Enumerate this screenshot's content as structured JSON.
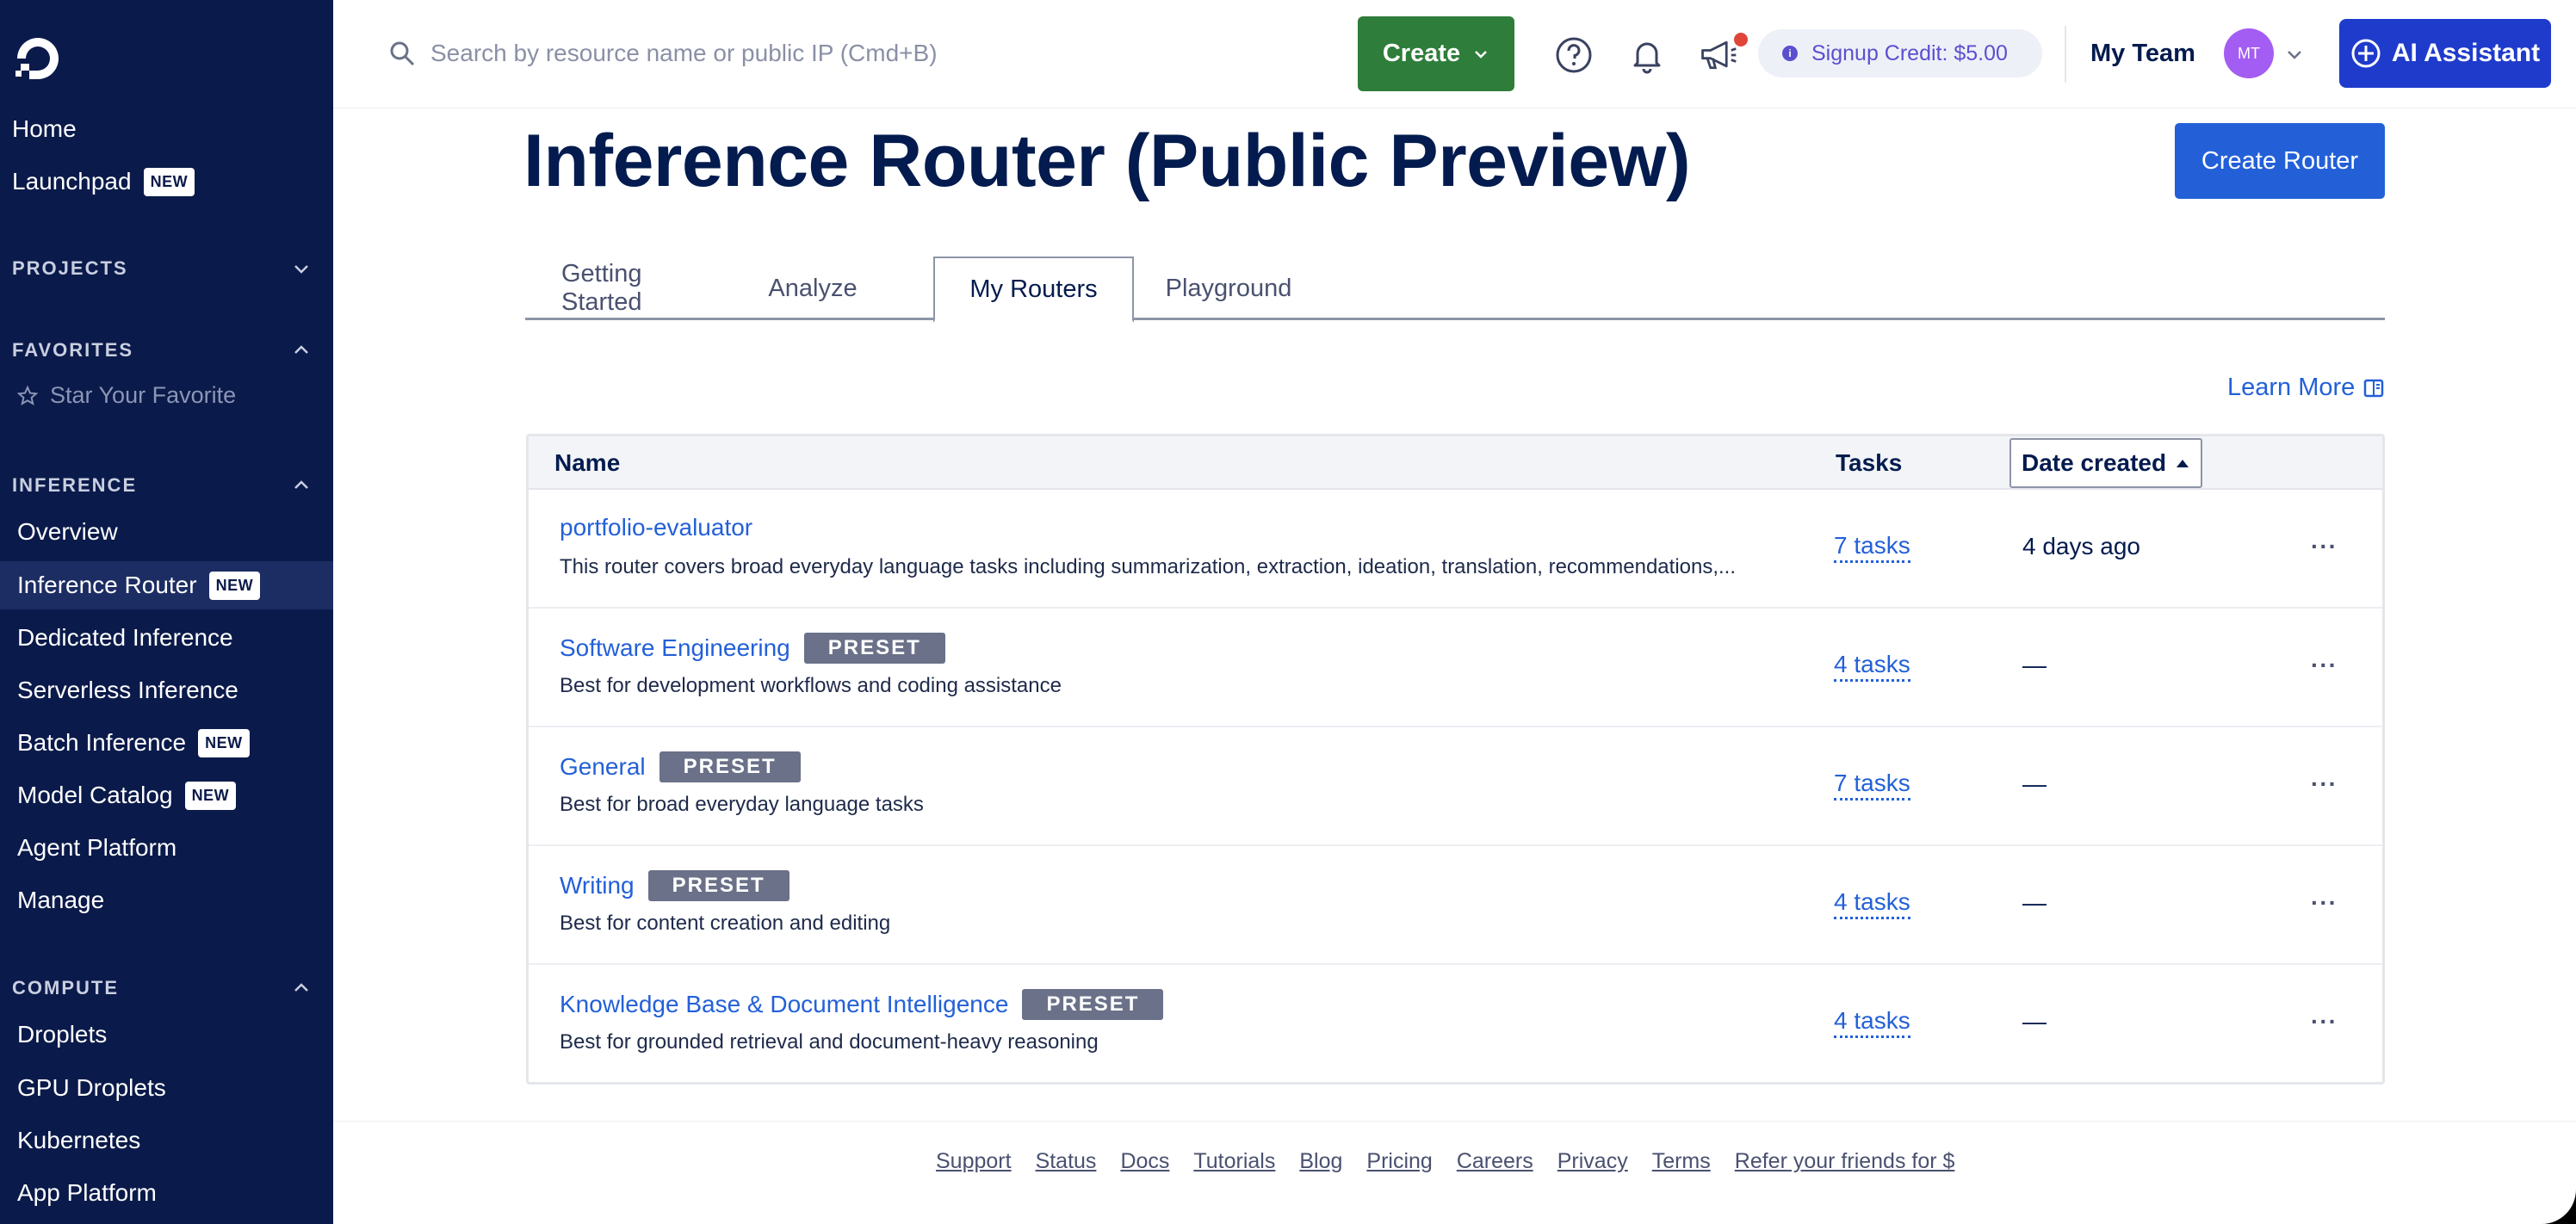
{
  "sidebar": {
    "home": "Home",
    "launchpad": "Launchpad",
    "new_badge": "NEW",
    "sections": {
      "projects": "PROJECTS",
      "favorites": "FAVORITES",
      "inference": "INFERENCE",
      "compute": "COMPUTE"
    },
    "star_favorite": "Star Your Favorite",
    "inference_items": [
      {
        "label": "Overview",
        "new": false,
        "active": false
      },
      {
        "label": "Inference Router",
        "new": true,
        "active": true
      },
      {
        "label": "Dedicated Inference",
        "new": false,
        "active": false
      },
      {
        "label": "Serverless Inference",
        "new": false,
        "active": false
      },
      {
        "label": "Batch Inference",
        "new": true,
        "active": false
      },
      {
        "label": "Model Catalog",
        "new": true,
        "active": false
      },
      {
        "label": "Agent Platform",
        "new": false,
        "active": false
      },
      {
        "label": "Manage",
        "new": false,
        "active": false
      }
    ],
    "compute_items": [
      "Droplets",
      "GPU Droplets",
      "Kubernetes",
      "App Platform"
    ]
  },
  "topbar": {
    "search_placeholder": "Search by resource name or public IP (Cmd+B)",
    "create_label": "Create",
    "credit_label": "Signup Credit: $5.00",
    "team_label": "My Team",
    "avatar_initials": "MT",
    "ai_assistant_label": "AI Assistant"
  },
  "main": {
    "title": "Inference Router (Public Preview)",
    "create_router_label": "Create Router",
    "tabs": [
      {
        "label": "Getting Started",
        "active": false
      },
      {
        "label": "Analyze",
        "active": false
      },
      {
        "label": "My Routers",
        "active": true
      },
      {
        "label": "Playground",
        "active": false
      }
    ],
    "learn_more": "Learn More",
    "table": {
      "headers": {
        "name": "Name",
        "tasks": "Tasks",
        "date": "Date created"
      },
      "rows": [
        {
          "name": "portfolio-evaluator",
          "preset": false,
          "desc": "This router covers broad everyday language tasks including summarization, extraction, ideation, translation, recommendations,...",
          "tasks": "7 tasks",
          "date": "4 days ago"
        },
        {
          "name": "Software Engineering",
          "preset": true,
          "desc": "Best for development workflows and coding assistance",
          "tasks": "4 tasks",
          "date": "—"
        },
        {
          "name": "General",
          "preset": true,
          "desc": "Best for broad everyday language tasks",
          "tasks": "7 tasks",
          "date": "—"
        },
        {
          "name": "Writing",
          "preset": true,
          "desc": "Best for content creation and editing",
          "tasks": "4 tasks",
          "date": "—"
        },
        {
          "name": "Knowledge Base & Document Intelligence",
          "preset": true,
          "desc": "Best for grounded retrieval and document-heavy reasoning",
          "tasks": "4 tasks",
          "date": "—"
        }
      ],
      "preset_label": "PRESET",
      "row_menu": "···"
    }
  },
  "footer": {
    "links": [
      "Support",
      "Status",
      "Docs",
      "Tutorials",
      "Blog",
      "Pricing",
      "Careers",
      "Privacy",
      "Terms",
      "Refer your friends for $"
    ]
  },
  "colors": {
    "sidebar_bg": "#0a1a4a",
    "primary": "#2360d8",
    "create_green": "#2e7d3a",
    "ai_blue": "#1f3bcc"
  }
}
